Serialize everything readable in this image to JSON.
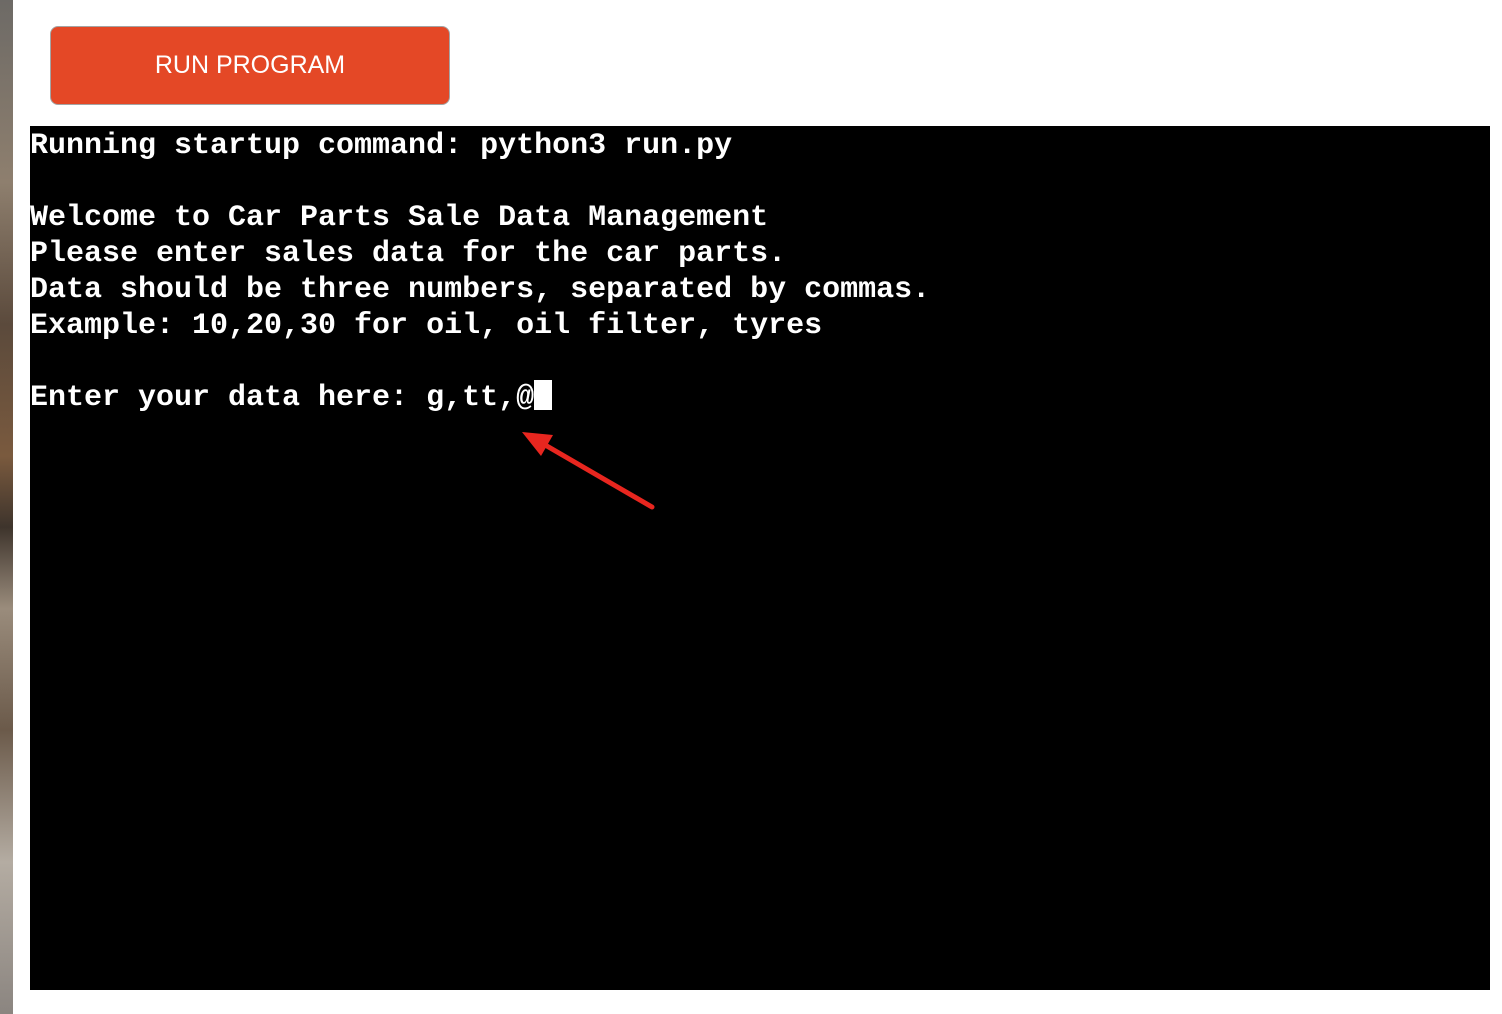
{
  "button": {
    "run_label": "RUN PROGRAM"
  },
  "terminal": {
    "lines": {
      "startup": "Running startup command: python3 run.py",
      "welcome": "Welcome to Car Parts Sale Data Management",
      "instruction": "Please enter sales data for the car parts.",
      "format": "Data should be three numbers, separated by commas.",
      "example": "Example: 10,20,30 for oil, oil filter, tyres"
    },
    "prompt": "Enter your data here: ",
    "input_value": "g,tt,@"
  },
  "colors": {
    "button_bg": "#e44826",
    "terminal_bg": "#000000",
    "terminal_text": "#ffffff",
    "annotation_arrow": "#e8261f"
  },
  "icons": {
    "annotation": "red-arrow-icon"
  }
}
